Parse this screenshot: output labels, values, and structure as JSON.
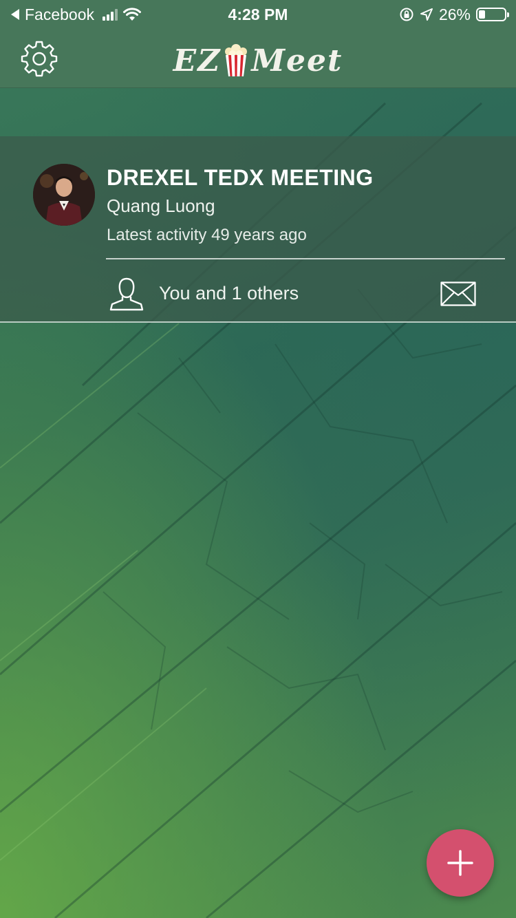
{
  "status_bar": {
    "back_app": "Facebook",
    "time": "4:28 PM",
    "battery_percent": "26%",
    "battery_level": 0.26,
    "icons": [
      "back-arrow-icon",
      "signal-bars-icon",
      "wifi-icon",
      "orientation-lock-icon",
      "location-arrow-icon",
      "battery-icon"
    ]
  },
  "header": {
    "logo_left": "EZ",
    "logo_right": "Meet",
    "icons": [
      "gear-icon",
      "popcorn-icon"
    ]
  },
  "meetings": [
    {
      "title": "DREXEL TEDX MEETING",
      "owner": "Quang Luong",
      "activity": "Latest activity 49 years ago",
      "members": "You and 1 others",
      "icons": [
        "avatar",
        "person-icon",
        "envelope-icon"
      ]
    }
  ],
  "fab": {
    "icon": "plus-icon"
  },
  "colors": {
    "header_bg": "#47775a",
    "fab_bg": "#d4506e",
    "card_bg": "rgba(60,90,75,0.72)"
  }
}
